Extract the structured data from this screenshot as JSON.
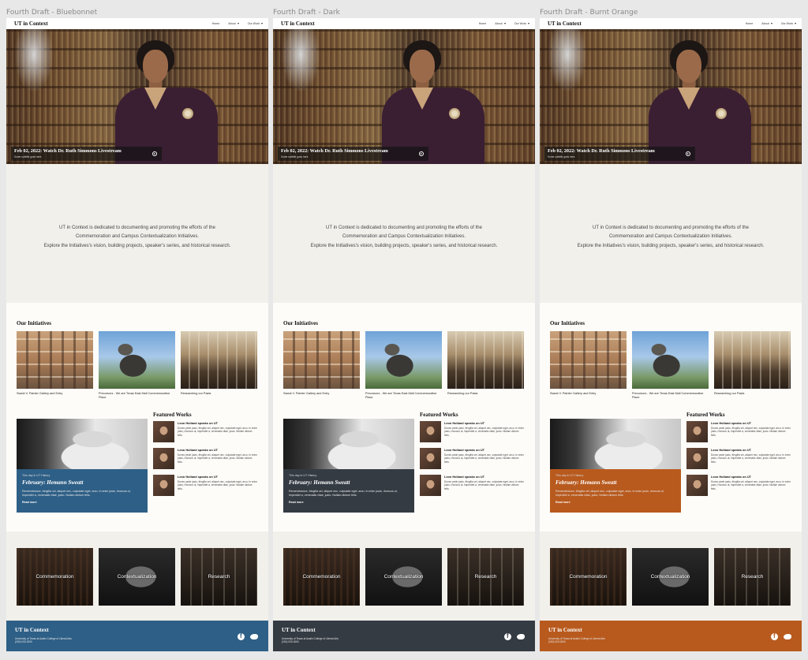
{
  "drafts": [
    {
      "label": "Fourth Draft - Bluebonnet",
      "accent": "#2e5f86",
      "nav": {
        "brand": "UT in Context",
        "links": [
          "Home",
          "About",
          "Our Work"
        ]
      },
      "hero": {
        "title": "Feb 02, 2022: Watch Dr. Ruth Simmons Livestream",
        "subtitle": "Some subtitle goes here."
      },
      "intro": [
        "UT in Context is dedicated to documenting and promoting the efforts of the",
        "Commemoration and Campus Contextualization Initiatives.",
        "Explore the Initiatives's vision, building projects, speaker's series, and historical research."
      ],
      "initiatives": {
        "heading": "Our Initiatives",
        "items": [
          "Sweat V. Painter Gallery and Entry",
          "Precursors - We are Texas East Mall Commemorative Place",
          "Researching our Pasts"
        ]
      },
      "feature": {
        "kicker": "This day in UT History",
        "title": "February: Hemann Sweatt",
        "body": "Remembrance, fringilla vel, aliquet nec, vulputate eget, arcu. In enim justo, rhoncus ut, imperdiet a, venenatis vitae, justo. Nullam dictum felis.",
        "more": "Read more"
      },
      "featured_works": {
        "heading": "Featured Works",
        "items": [
          {
            "title": "Leon Holland speaks on UT",
            "text": "Donec pede justo, fringilla vel, aliquet nec, vulputate eget, arcu. In enim justo, rhoncus ut, imperdiet a, venenatis vitae, justo. Nullam dictum felis."
          },
          {
            "title": "Leon Holland speaks on UT",
            "text": "Donec pede justo, fringilla vel, aliquet nec, vulputate eget, arcu. In enim justo, rhoncus ut, imperdiet a, venenatis vitae, justo. Nullam dictum felis."
          },
          {
            "title": "Leon Holland speaks on UT",
            "text": "Donec pede justo, fringilla vel, aliquet nec, vulputate eget, arcu. In enim justo, rhoncus ut, imperdiet a, venenatis vitae, justo. Nullam dictum felis."
          }
        ]
      },
      "pillars": [
        "Commemoration",
        "Contextualization",
        "Research"
      ],
      "footer": {
        "brand": "UT in Context",
        "line1": "University of Texas at Austin College of Liberal Arts",
        "line2": "(000) 000-0000"
      }
    },
    {
      "label": "Fourth Draft - Dark",
      "accent": "#343b43",
      "nav": {
        "brand": "UT in Context",
        "links": [
          "Home",
          "About",
          "Our Work"
        ]
      },
      "hero": {
        "title": "Feb 02, 2022: Watch Dr. Ruth Simmons Livestream",
        "subtitle": "Some subtitle goes here."
      },
      "intro": [
        "UT in Context is dedicated to documenting and promoting the efforts of the",
        "Commemoration and Campus Contextualization Initiatives.",
        "Explore the Initiatives's vision, building projects, speaker's series, and historical research."
      ],
      "initiatives": {
        "heading": "Our Initiatives",
        "items": [
          "Sweat V. Painter Gallery and Entry",
          "Precursors - We are Texas East Mall Commemorative Place",
          "Researching our Pasts"
        ]
      },
      "feature": {
        "kicker": "This day in UT History",
        "title": "February: Hemann Sweatt",
        "body": "Remembrance, fringilla vel, aliquet nec, vulputate eget, arcu. In enim justo, rhoncus ut, imperdiet a, venenatis vitae, justo. Nullam dictum felis.",
        "more": "Read more"
      },
      "featured_works": {
        "heading": "Featured Works",
        "items": [
          {
            "title": "Leon Holland speaks on UT",
            "text": "Donec pede justo, fringilla vel, aliquet nec, vulputate eget, arcu. In enim justo, rhoncus ut, imperdiet a, venenatis vitae, justo. Nullam dictum felis."
          },
          {
            "title": "Leon Holland speaks on UT",
            "text": "Donec pede justo, fringilla vel, aliquet nec, vulputate eget, arcu. In enim justo, rhoncus ut, imperdiet a, venenatis vitae, justo. Nullam dictum felis."
          },
          {
            "title": "Leon Holland speaks on UT",
            "text": "Donec pede justo, fringilla vel, aliquet nec, vulputate eget, arcu. In enim justo, rhoncus ut, imperdiet a, venenatis vitae, justo. Nullam dictum felis."
          }
        ]
      },
      "pillars": [
        "Commemoration",
        "Contextualization",
        "Research"
      ],
      "footer": {
        "brand": "UT in Context",
        "line1": "University of Texas at Austin College of Liberal Arts",
        "line2": "(000) 000-0000"
      }
    },
    {
      "label": "Fourth Draft - Burnt Orange",
      "accent": "#b85a1e",
      "nav": {
        "brand": "UT in Context",
        "links": [
          "Home",
          "About",
          "Our Work"
        ]
      },
      "hero": {
        "title": "Feb 02, 2022: Watch Dr. Ruth Simmons Livestream",
        "subtitle": "Some subtitle goes here."
      },
      "intro": [
        "UT in Context is dedicated to documenting and promoting the efforts of the",
        "Commemoration and Campus Contextualization Initiatives.",
        "Explore the Initiatives's vision, building projects, speaker's series, and historical research."
      ],
      "initiatives": {
        "heading": "Our Initiatives",
        "items": [
          "Sweat V. Painter Gallery and Entry",
          "Precursors - We are Texas East Mall Commemorative Place",
          "Researching our Pasts"
        ]
      },
      "feature": {
        "kicker": "This day in UT History",
        "title": "February: Hemann Sweatt",
        "body": "Remembrance, fringilla vel, aliquet nec, vulputate eget, arcu. In enim justo, rhoncus ut, imperdiet a, venenatis vitae, justo. Nullam dictum felis.",
        "more": "Read more"
      },
      "featured_works": {
        "heading": "Featured Works",
        "items": [
          {
            "title": "Leon Holland speaks on UT",
            "text": "Donec pede justo, fringilla vel, aliquet nec, vulputate eget, arcu. In enim justo, rhoncus ut, imperdiet a, venenatis vitae, justo. Nullam dictum felis."
          },
          {
            "title": "Leon Holland speaks on UT",
            "text": "Donec pede justo, fringilla vel, aliquet nec, vulputate eget, arcu. In enim justo, rhoncus ut, imperdiet a, venenatis vitae, justo. Nullam dictum felis."
          },
          {
            "title": "Leon Holland speaks on UT",
            "text": "Donec pede justo, fringilla vel, aliquet nec, vulputate eget, arcu. In enim justo, rhoncus ut, imperdiet a, venenatis vitae, justo. Nullam dictum felis."
          }
        ]
      },
      "pillars": [
        "Commemoration",
        "Contextualization",
        "Research"
      ],
      "footer": {
        "brand": "UT in Context",
        "line1": "University of Texas at Austin College of Liberal Arts",
        "line2": "(000) 000-0000"
      }
    }
  ]
}
